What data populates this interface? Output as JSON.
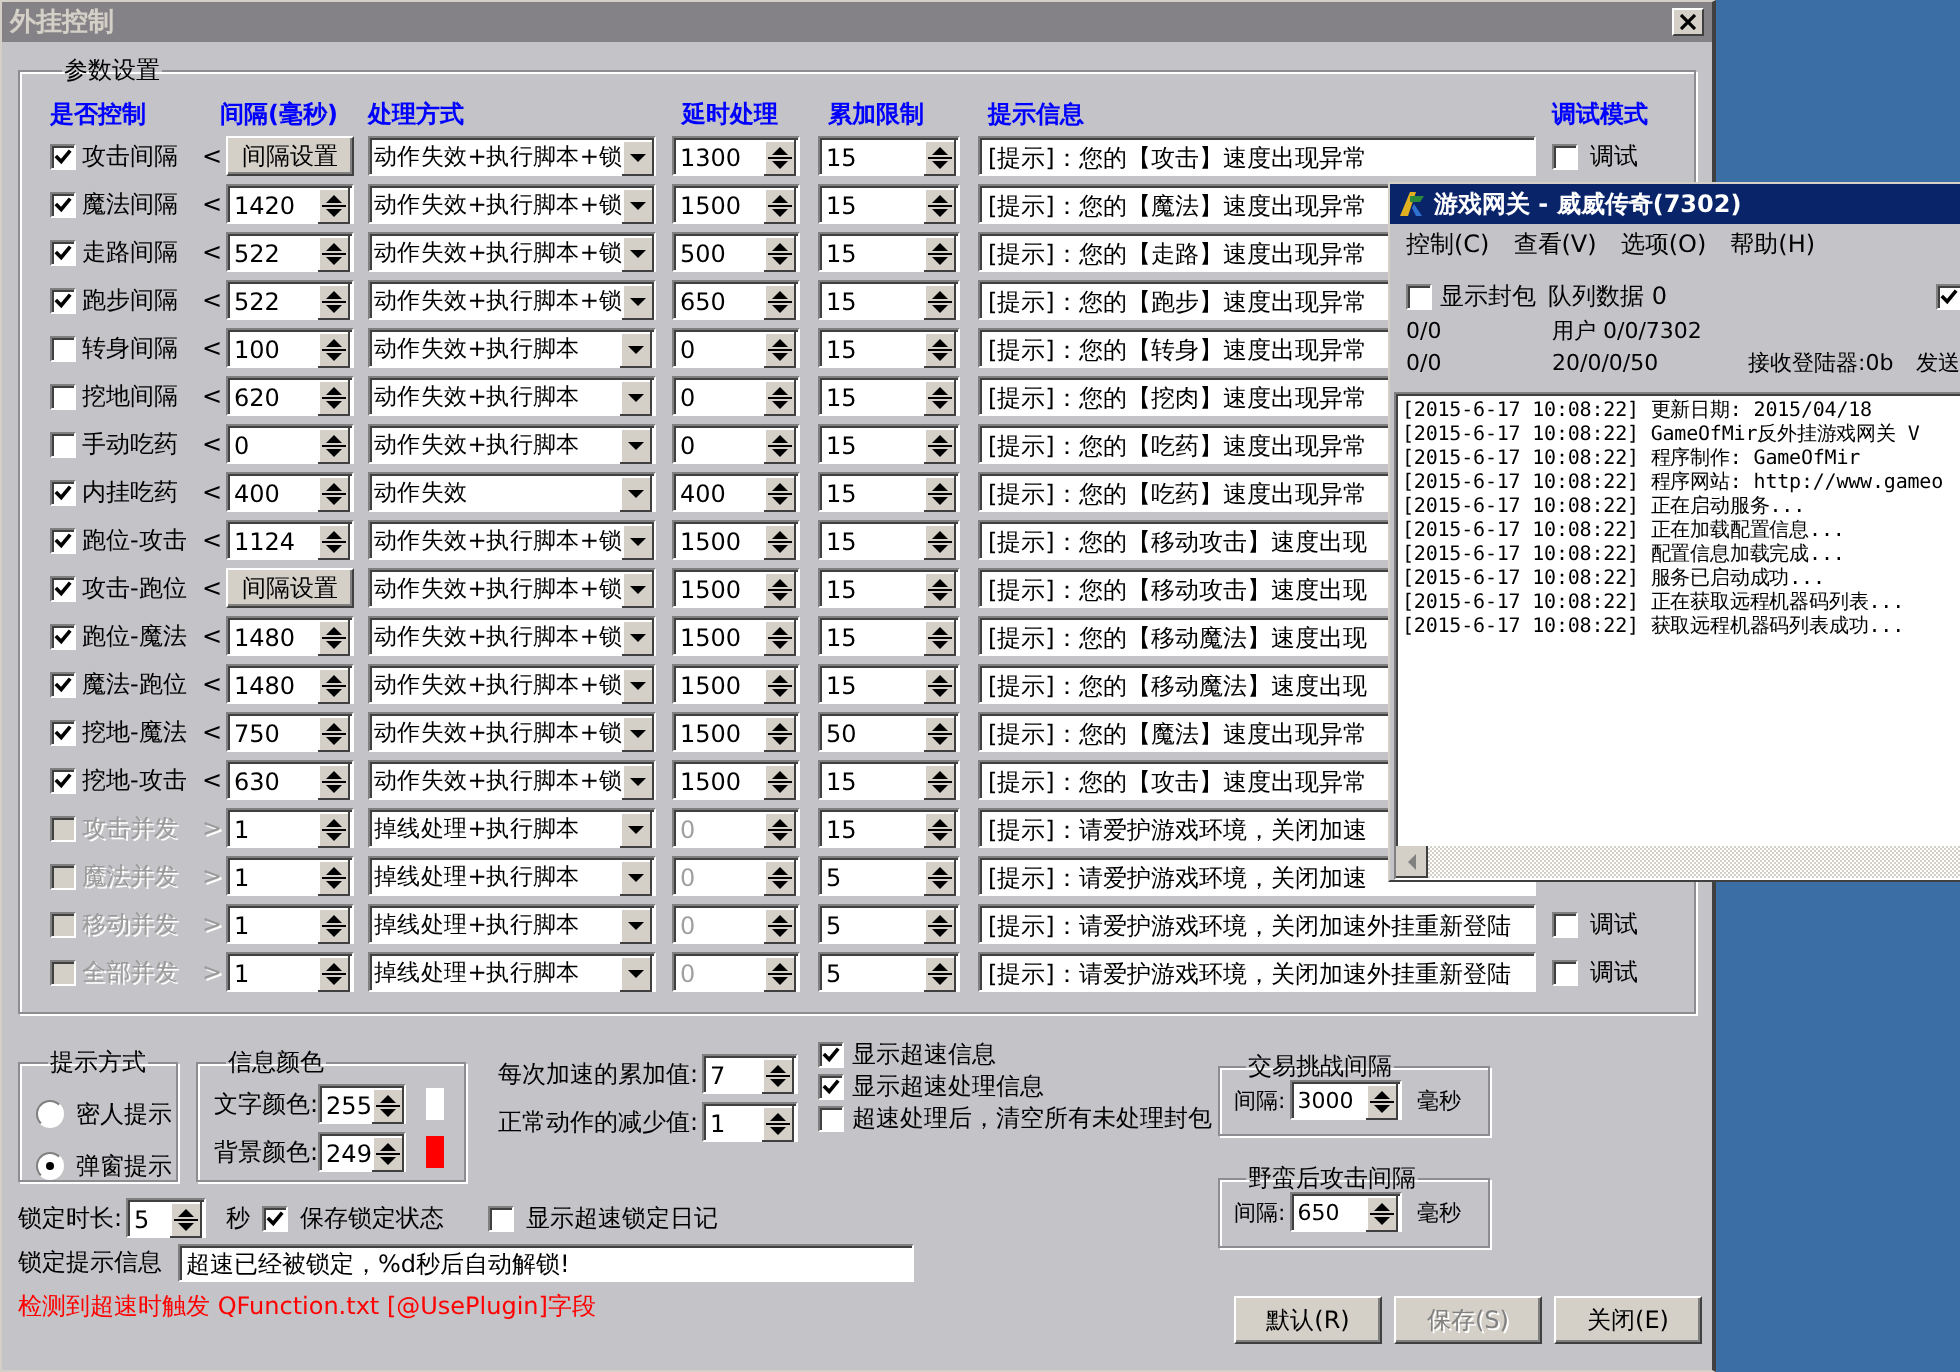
{
  "window": {
    "title": "外挂控制"
  },
  "params": {
    "title": "参数设置",
    "headers": [
      "是否控制",
      "间隔(毫秒)",
      "处理方式",
      "延时处理",
      "累加限制",
      "提示信息",
      "调试模式"
    ],
    "rows": [
      {
        "label": "攻击间隔",
        "arrow": "<",
        "checked": true,
        "disabled": false,
        "interval": {
          "kind": "button",
          "value": "间隔设置"
        },
        "action": "动作失效+执行脚本+锁",
        "delay": "1300",
        "limit": "15",
        "tip": "[提示]：您的【攻击】速度出现异常",
        "debug": {
          "label": "调试",
          "checked": false
        }
      },
      {
        "label": "魔法间隔",
        "arrow": "<",
        "checked": true,
        "disabled": false,
        "interval": {
          "kind": "spin",
          "value": "1420"
        },
        "action": "动作失效+执行脚本+锁",
        "delay": "1500",
        "limit": "15",
        "tip": "[提示]：您的【魔法】速度出现异常"
      },
      {
        "label": "走路间隔",
        "arrow": "<",
        "checked": true,
        "disabled": false,
        "interval": {
          "kind": "spin",
          "value": "522"
        },
        "action": "动作失效+执行脚本+锁",
        "delay": "500",
        "limit": "15",
        "tip": "[提示]：您的【走路】速度出现异常"
      },
      {
        "label": "跑步间隔",
        "arrow": "<",
        "checked": true,
        "disabled": false,
        "interval": {
          "kind": "spin",
          "value": "522"
        },
        "action": "动作失效+执行脚本+锁",
        "delay": "650",
        "limit": "15",
        "tip": "[提示]：您的【跑步】速度出现异常"
      },
      {
        "label": "转身间隔",
        "arrow": "<",
        "checked": false,
        "disabled": false,
        "interval": {
          "kind": "spin",
          "value": "100"
        },
        "action": "动作失效+执行脚本",
        "delay": "0",
        "limit": "15",
        "tip": "[提示]：您的【转身】速度出现异常"
      },
      {
        "label": "挖地间隔",
        "arrow": "<",
        "checked": false,
        "disabled": false,
        "interval": {
          "kind": "spin",
          "value": "620"
        },
        "action": "动作失效+执行脚本",
        "delay": "0",
        "limit": "15",
        "tip": "[提示]：您的【挖肉】速度出现异常"
      },
      {
        "label": "手动吃药",
        "arrow": "<",
        "checked": false,
        "disabled": false,
        "interval": {
          "kind": "spin",
          "value": "0"
        },
        "action": "动作失效+执行脚本",
        "delay": "0",
        "limit": "15",
        "tip": "[提示]：您的【吃药】速度出现异常"
      },
      {
        "label": "内挂吃药",
        "arrow": "<",
        "checked": true,
        "disabled": false,
        "interval": {
          "kind": "spin",
          "value": "400"
        },
        "action": "动作失效",
        "delay": "400",
        "limit": "15",
        "tip": "[提示]：您的【吃药】速度出现异常"
      },
      {
        "label": "跑位-攻击",
        "arrow": "<",
        "checked": true,
        "disabled": false,
        "interval": {
          "kind": "spin",
          "value": "1124"
        },
        "action": "动作失效+执行脚本+锁",
        "delay": "1500",
        "limit": "15",
        "tip": "[提示]：您的【移动攻击】速度出现"
      },
      {
        "label": "攻击-跑位",
        "arrow": "<",
        "checked": true,
        "disabled": false,
        "interval": {
          "kind": "button",
          "value": "间隔设置"
        },
        "action": "动作失效+执行脚本+锁",
        "delay": "1500",
        "limit": "15",
        "tip": "[提示]：您的【移动攻击】速度出现"
      },
      {
        "label": "跑位-魔法",
        "arrow": "<",
        "checked": true,
        "disabled": false,
        "interval": {
          "kind": "spin",
          "value": "1480"
        },
        "action": "动作失效+执行脚本+锁",
        "delay": "1500",
        "limit": "15",
        "tip": "[提示]：您的【移动魔法】速度出现"
      },
      {
        "label": "魔法-跑位",
        "arrow": "<",
        "checked": true,
        "disabled": false,
        "interval": {
          "kind": "spin",
          "value": "1480"
        },
        "action": "动作失效+执行脚本+锁",
        "delay": "1500",
        "limit": "15",
        "tip": "[提示]：您的【移动魔法】速度出现"
      },
      {
        "label": "挖地-魔法",
        "arrow": "<",
        "checked": true,
        "disabled": false,
        "interval": {
          "kind": "spin",
          "value": "750"
        },
        "action": "动作失效+执行脚本+锁",
        "delay": "1500",
        "limit": "50",
        "tip": "[提示]：您的【魔法】速度出现异常"
      },
      {
        "label": "挖地-攻击",
        "arrow": "<",
        "checked": true,
        "disabled": false,
        "interval": {
          "kind": "spin",
          "value": "630"
        },
        "action": "动作失效+执行脚本+锁",
        "delay": "1500",
        "limit": "15",
        "tip": "[提示]：您的【攻击】速度出现异常"
      },
      {
        "label": "攻击并发",
        "arrow": ">",
        "checked": false,
        "disabled": true,
        "interval": {
          "kind": "spin",
          "value": "1"
        },
        "action": "掉线处理+执行脚本",
        "delay": "0",
        "limit": "15",
        "tip": "[提示]：请爱护游戏环境，关闭加速"
      },
      {
        "label": "魔法并发",
        "arrow": ">",
        "checked": false,
        "disabled": true,
        "interval": {
          "kind": "spin",
          "value": "1"
        },
        "action": "掉线处理+执行脚本",
        "delay": "0",
        "limit": "5",
        "tip": "[提示]：请爱护游戏环境，关闭加速"
      },
      {
        "label": "移动并发",
        "arrow": ">",
        "checked": false,
        "disabled": true,
        "interval": {
          "kind": "spin",
          "value": "1"
        },
        "action": "掉线处理+执行脚本",
        "delay": "0",
        "limit": "5",
        "tip": "[提示]：请爱护游戏环境，关闭加速外挂重新登陆",
        "debug": {
          "label": "调试",
          "checked": false
        }
      },
      {
        "label": "全部并发",
        "arrow": ">",
        "checked": false,
        "disabled": true,
        "interval": {
          "kind": "spin",
          "value": "1"
        },
        "action": "掉线处理+执行脚本",
        "delay": "0",
        "limit": "5",
        "tip": "[提示]：请爱护游戏环境，关闭加速外挂重新登陆",
        "debug": {
          "label": "调试",
          "checked": false
        }
      }
    ]
  },
  "prompt_mode": {
    "title": "提示方式",
    "options": [
      {
        "label": "密人提示",
        "selected": false
      },
      {
        "label": "弹窗提示",
        "selected": true
      }
    ]
  },
  "info_color": {
    "title": "信息颜色",
    "items": [
      {
        "label": "文字颜色:",
        "value": "255",
        "color": "#ffffff"
      },
      {
        "label": "背景颜色:",
        "value": "249",
        "color": "#ff0000"
      }
    ]
  },
  "accel": [
    {
      "label": "每次加速的累加值:",
      "value": "7"
    },
    {
      "label": "正常动作的减少值:",
      "value": "1"
    }
  ],
  "options": [
    {
      "label": "显示超速信息",
      "checked": true
    },
    {
      "label": "显示超速处理信息",
      "checked": true
    },
    {
      "label": "超速处理后，清空所有未处理封包",
      "checked": false
    }
  ],
  "intervals": [
    {
      "title": "交易挑战间隔",
      "label": "间隔:",
      "value": "3000",
      "unit": "毫秒"
    },
    {
      "title": "野蛮后攻击间隔",
      "label": "间隔:",
      "value": "650",
      "unit": "毫秒"
    }
  ],
  "lock": {
    "label": "锁定时长:",
    "value": "5",
    "unit": "秒",
    "save_state": {
      "label": "保存锁定状态",
      "checked": true
    },
    "show_log": {
      "label": "显示超速锁定日记",
      "checked": false
    },
    "message_label": "锁定提示信息",
    "message": "超速已经被锁定，%d秒后自动解锁!"
  },
  "note": "检测到超速时触发 QFunction.txt [@UsePlugin]字段",
  "buttons": [
    {
      "label": "默认(R)",
      "disabled": false
    },
    {
      "label": "保存(S)",
      "disabled": true
    },
    {
      "label": "关闭(E)",
      "disabled": false
    }
  ],
  "gateway": {
    "title": "游戏网关 - 威威传奇(7302)",
    "menu": [
      "控制(C)",
      "查看(V)",
      "选项(O)",
      "帮助(H)"
    ],
    "show_packets": {
      "label": "显示封包",
      "checked": false
    },
    "queue": "队列数据 0",
    "right_checkbox": {
      "checked": true
    },
    "stats": [
      [
        "0/0",
        "用户 0/0/7302"
      ],
      [
        "0/0",
        "20/0/0/50",
        "接收登陆器:0b",
        "发送"
      ]
    ],
    "log": [
      "[2015-6-17 10:08:22] 更新日期: 2015/04/18",
      "[2015-6-17 10:08:22] GameOfMir反外挂游戏网关 V",
      "[2015-6-17 10:08:22] 程序制作: GameOfMir",
      "[2015-6-17 10:08:22] 程序网站: http://www.gameo",
      "[2015-6-17 10:08:22] 正在启动服务...",
      "[2015-6-17 10:08:22] 正在加载配置信息...",
      "[2015-6-17 10:08:22] 配置信息加载完成...",
      "[2015-6-17 10:08:22] 服务已启动成功...",
      "[2015-6-17 10:08:22] 正在获取远程机器码列表...",
      "[2015-6-17 10:08:22] 获取远程机器码列表成功..."
    ]
  }
}
